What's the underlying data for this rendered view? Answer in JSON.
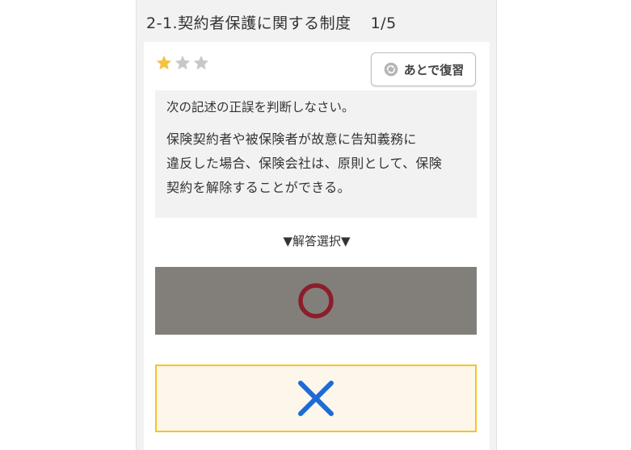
{
  "header": {
    "title": "2-1.契約者保護に関する制度",
    "progress": "1/5"
  },
  "rating": {
    "filled": 1,
    "total": 3,
    "filled_color": "#f5c242",
    "empty_color": "#c8c8c8"
  },
  "review_button": {
    "label": "あとで復習",
    "icon": "recycle-icon"
  },
  "question": {
    "instruction": "次の記述の正誤を判断しなさい。",
    "text_lines": [
      "保険契約者や被保険者が故意に告知義務に",
      "違反した場合、保険会社は、原則として、保険",
      "契約を解除することができる。"
    ]
  },
  "answer_section": {
    "heading": "▼解答選択▼",
    "options": [
      {
        "symbol": "circle-icon",
        "meaning": "true",
        "bg_color": "#827f7b",
        "symbol_color": "#8b1e2b"
      },
      {
        "symbol": "cross-icon",
        "meaning": "false",
        "bg_color": "#fdf6ea",
        "border_color": "#f4c520",
        "symbol_color": "#1e6bd6"
      }
    ]
  }
}
